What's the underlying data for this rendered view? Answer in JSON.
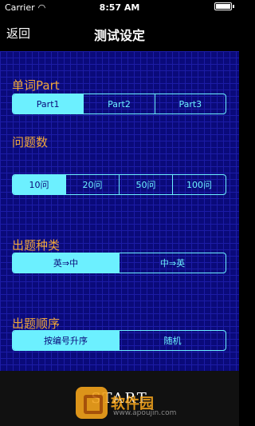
{
  "status_bar": {
    "carrier": "Carrier",
    "time": "8:57 AM"
  },
  "nav": {
    "back_label": "返回",
    "title": "测试设定"
  },
  "sections": [
    {
      "label": "单词Part",
      "options": [
        "Part1",
        "Part2",
        "Part3"
      ],
      "selected": 0
    },
    {
      "label": "问题数",
      "options": [
        "10问",
        "20问",
        "50问",
        "100问"
      ],
      "selected": 0
    },
    {
      "label": "出题种类",
      "options": [
        "英⇒中",
        "中⇒英"
      ],
      "selected": 0
    },
    {
      "label": "出题顺序",
      "options": [
        "按编号升序",
        "随机"
      ],
      "selected": 0
    }
  ],
  "start_button": {
    "label": "START"
  },
  "watermark": {
    "text": "软件园",
    "url": "www.apoujin.com"
  },
  "colors": {
    "accent": "#6cf0ff",
    "section_label": "#f0a63a",
    "background": "#0a0a7a"
  }
}
